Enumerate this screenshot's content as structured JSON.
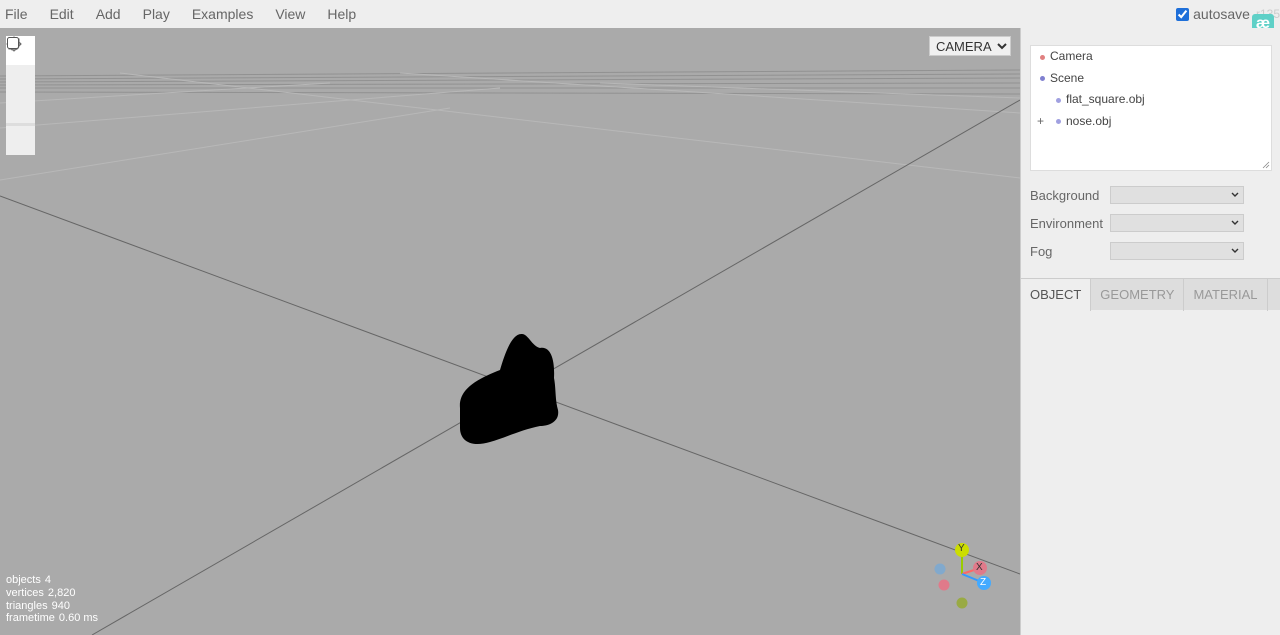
{
  "menubar": {
    "items": [
      "File",
      "Edit",
      "Add",
      "Play",
      "Examples",
      "View",
      "Help"
    ],
    "autosave_label": "autosave",
    "autosave_checked": true,
    "version": "r135",
    "logo": "æ"
  },
  "viewport": {
    "camera_select": "CAMERA",
    "info": {
      "objects_label": "objects",
      "objects": "4",
      "vertices_label": "vertices",
      "vertices": "2,820",
      "triangles_label": "triangles",
      "triangles": "940",
      "frametime_label": "frametime",
      "frametime": "0.60 ms"
    },
    "toolbar": [
      "move-icon",
      "rotate-icon",
      "scale-icon",
      "local-space-icon"
    ],
    "gizmo": {
      "y": "Y",
      "x": "X",
      "z": "Z"
    }
  },
  "sidebar": {
    "outliner": [
      {
        "label": "Camera",
        "color": "#e08080"
      },
      {
        "label": "Scene",
        "color": "#8080d0"
      },
      {
        "label": "flat_square.obj",
        "color": "#a0a0e0"
      },
      {
        "label": "nose.obj",
        "color": "#a0a0e0",
        "opener": "+"
      }
    ],
    "properties": {
      "background_label": "Background",
      "environment_label": "Environment",
      "fog_label": "Fog"
    },
    "tabs": [
      "OBJECT",
      "GEOMETRY",
      "MATERIAL"
    ]
  }
}
